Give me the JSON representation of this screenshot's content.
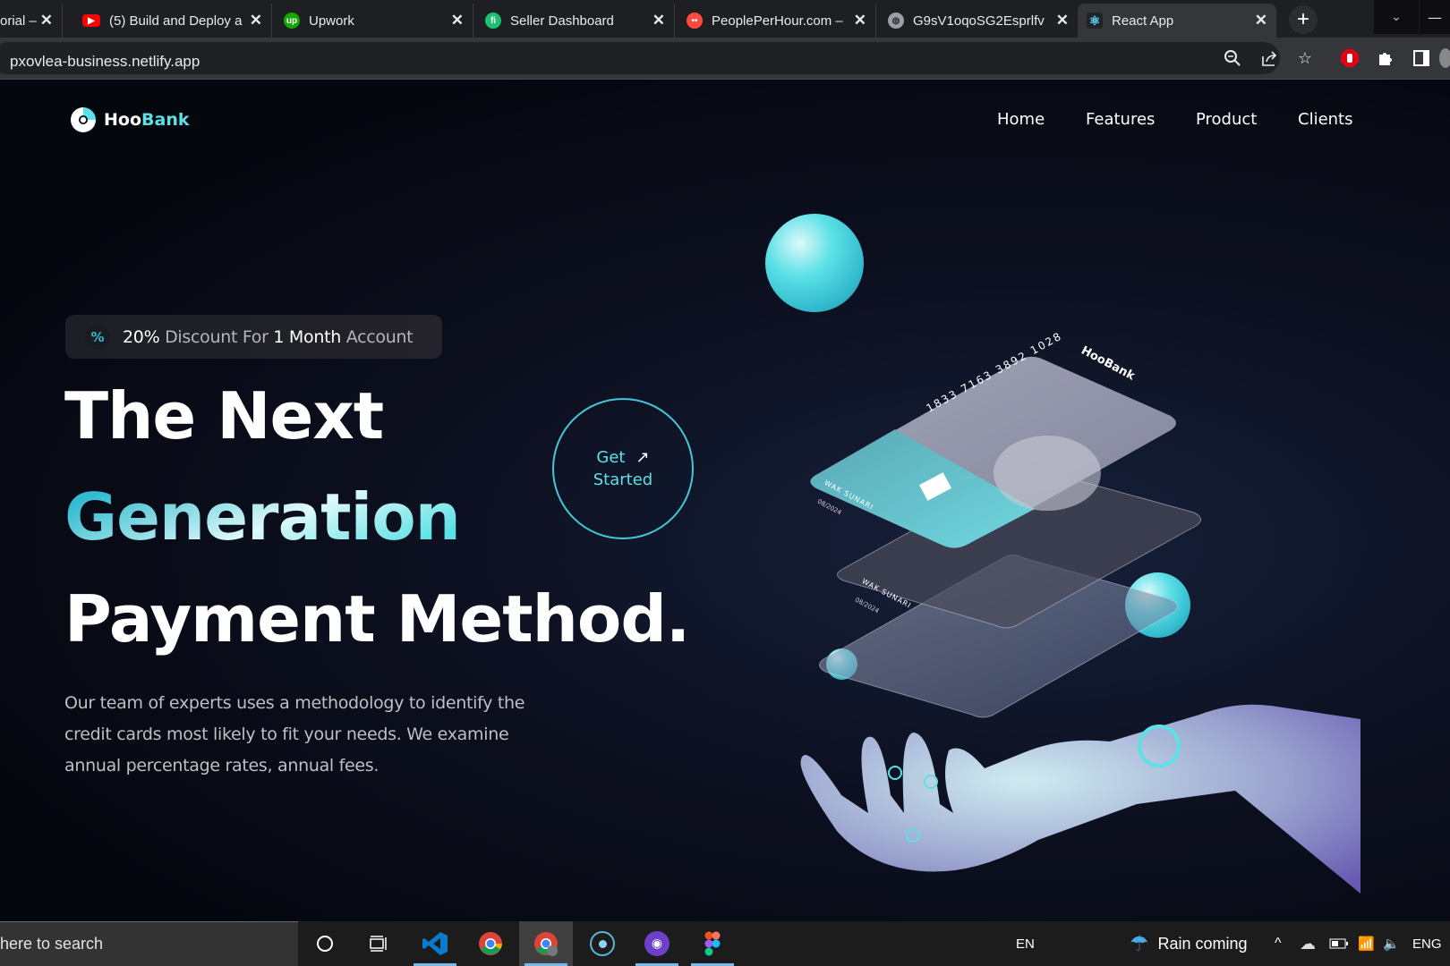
{
  "browser": {
    "tabs": [
      {
        "label": "orial –",
        "icon": "tab-favicon",
        "color": "#888888"
      },
      {
        "label": "(5) Build and Deploy a",
        "icon": "youtube-icon",
        "color": "#ff0000"
      },
      {
        "label": "Upwork",
        "icon": "upwork-icon",
        "color": "#14a800"
      },
      {
        "label": "Seller Dashboard",
        "icon": "fiverr-icon",
        "color": "#1dbf73"
      },
      {
        "label": "PeoplePerHour.com –",
        "icon": "peopleperhour-icon",
        "color": "#ff4a3d"
      },
      {
        "label": "G9sV1oqoSG2Esprlfv",
        "icon": "globe-icon",
        "color": "#9aa0a6"
      },
      {
        "label": "React App",
        "icon": "react-icon",
        "color": "#61dafb",
        "active": true
      }
    ],
    "close_glyph": "✕",
    "new_tab_glyph": "+",
    "url": "pxovlea-business.netlify.app"
  },
  "site": {
    "logo": {
      "part1": "Hoo",
      "part2": "Bank"
    },
    "nav": [
      "Home",
      "Features",
      "Product",
      "Clients"
    ],
    "badge": {
      "icon": "percent-icon",
      "glyph": "%",
      "strong1": "20%",
      "text1": " Discount For ",
      "strong2": "1",
      "text2": " Month",
      "text3": " Account"
    },
    "headline": {
      "line1": "The Next",
      "line2": "Generation",
      "line3": "Payment Method."
    },
    "cta": {
      "line1": "Get",
      "arrow": "↗",
      "line2": "Started"
    },
    "description": "Our team of experts uses a methodology to identify the credit cards most likely to fit your needs. We examine annual percentage rates, annual fees.",
    "card": {
      "number": "1833 7163 3892 1028",
      "holder": "WAK SUNARI",
      "expiry": "08/2024",
      "brand": "HooBank"
    },
    "colors": {
      "accent": "#5ce1e6",
      "accent_dark": "#33bbcf",
      "background": "#00040f"
    }
  },
  "taskbar": {
    "search_placeholder": "here to search",
    "language_short": "EN",
    "weather": "Rain coming",
    "language": "ENG"
  }
}
